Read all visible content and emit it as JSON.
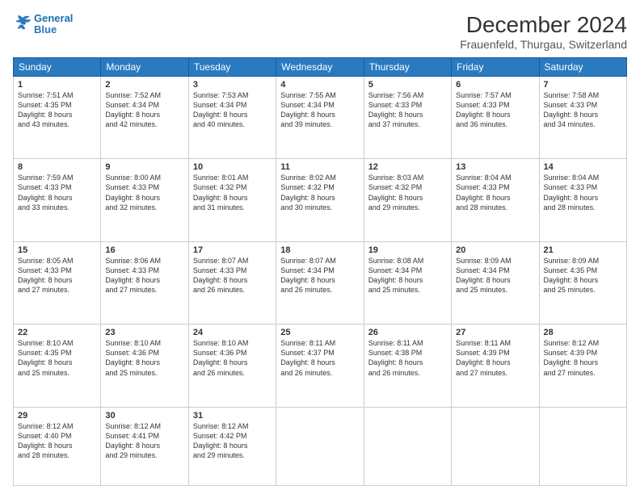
{
  "header": {
    "logo_line1": "General",
    "logo_line2": "Blue",
    "title": "December 2024",
    "subtitle": "Frauenfeld, Thurgau, Switzerland"
  },
  "weekdays": [
    "Sunday",
    "Monday",
    "Tuesday",
    "Wednesday",
    "Thursday",
    "Friday",
    "Saturday"
  ],
  "weeks": [
    [
      {
        "day": "1",
        "lines": [
          "Sunrise: 7:51 AM",
          "Sunset: 4:35 PM",
          "Daylight: 8 hours",
          "and 43 minutes."
        ]
      },
      {
        "day": "2",
        "lines": [
          "Sunrise: 7:52 AM",
          "Sunset: 4:34 PM",
          "Daylight: 8 hours",
          "and 42 minutes."
        ]
      },
      {
        "day": "3",
        "lines": [
          "Sunrise: 7:53 AM",
          "Sunset: 4:34 PM",
          "Daylight: 8 hours",
          "and 40 minutes."
        ]
      },
      {
        "day": "4",
        "lines": [
          "Sunrise: 7:55 AM",
          "Sunset: 4:34 PM",
          "Daylight: 8 hours",
          "and 39 minutes."
        ]
      },
      {
        "day": "5",
        "lines": [
          "Sunrise: 7:56 AM",
          "Sunset: 4:33 PM",
          "Daylight: 8 hours",
          "and 37 minutes."
        ]
      },
      {
        "day": "6",
        "lines": [
          "Sunrise: 7:57 AM",
          "Sunset: 4:33 PM",
          "Daylight: 8 hours",
          "and 36 minutes."
        ]
      },
      {
        "day": "7",
        "lines": [
          "Sunrise: 7:58 AM",
          "Sunset: 4:33 PM",
          "Daylight: 8 hours",
          "and 34 minutes."
        ]
      }
    ],
    [
      {
        "day": "8",
        "lines": [
          "Sunrise: 7:59 AM",
          "Sunset: 4:33 PM",
          "Daylight: 8 hours",
          "and 33 minutes."
        ]
      },
      {
        "day": "9",
        "lines": [
          "Sunrise: 8:00 AM",
          "Sunset: 4:33 PM",
          "Daylight: 8 hours",
          "and 32 minutes."
        ]
      },
      {
        "day": "10",
        "lines": [
          "Sunrise: 8:01 AM",
          "Sunset: 4:32 PM",
          "Daylight: 8 hours",
          "and 31 minutes."
        ]
      },
      {
        "day": "11",
        "lines": [
          "Sunrise: 8:02 AM",
          "Sunset: 4:32 PM",
          "Daylight: 8 hours",
          "and 30 minutes."
        ]
      },
      {
        "day": "12",
        "lines": [
          "Sunrise: 8:03 AM",
          "Sunset: 4:32 PM",
          "Daylight: 8 hours",
          "and 29 minutes."
        ]
      },
      {
        "day": "13",
        "lines": [
          "Sunrise: 8:04 AM",
          "Sunset: 4:33 PM",
          "Daylight: 8 hours",
          "and 28 minutes."
        ]
      },
      {
        "day": "14",
        "lines": [
          "Sunrise: 8:04 AM",
          "Sunset: 4:33 PM",
          "Daylight: 8 hours",
          "and 28 minutes."
        ]
      }
    ],
    [
      {
        "day": "15",
        "lines": [
          "Sunrise: 8:05 AM",
          "Sunset: 4:33 PM",
          "Daylight: 8 hours",
          "and 27 minutes."
        ]
      },
      {
        "day": "16",
        "lines": [
          "Sunrise: 8:06 AM",
          "Sunset: 4:33 PM",
          "Daylight: 8 hours",
          "and 27 minutes."
        ]
      },
      {
        "day": "17",
        "lines": [
          "Sunrise: 8:07 AM",
          "Sunset: 4:33 PM",
          "Daylight: 8 hours",
          "and 26 minutes."
        ]
      },
      {
        "day": "18",
        "lines": [
          "Sunrise: 8:07 AM",
          "Sunset: 4:34 PM",
          "Daylight: 8 hours",
          "and 26 minutes."
        ]
      },
      {
        "day": "19",
        "lines": [
          "Sunrise: 8:08 AM",
          "Sunset: 4:34 PM",
          "Daylight: 8 hours",
          "and 25 minutes."
        ]
      },
      {
        "day": "20",
        "lines": [
          "Sunrise: 8:09 AM",
          "Sunset: 4:34 PM",
          "Daylight: 8 hours",
          "and 25 minutes."
        ]
      },
      {
        "day": "21",
        "lines": [
          "Sunrise: 8:09 AM",
          "Sunset: 4:35 PM",
          "Daylight: 8 hours",
          "and 25 minutes."
        ]
      }
    ],
    [
      {
        "day": "22",
        "lines": [
          "Sunrise: 8:10 AM",
          "Sunset: 4:35 PM",
          "Daylight: 8 hours",
          "and 25 minutes."
        ]
      },
      {
        "day": "23",
        "lines": [
          "Sunrise: 8:10 AM",
          "Sunset: 4:36 PM",
          "Daylight: 8 hours",
          "and 25 minutes."
        ]
      },
      {
        "day": "24",
        "lines": [
          "Sunrise: 8:10 AM",
          "Sunset: 4:36 PM",
          "Daylight: 8 hours",
          "and 26 minutes."
        ]
      },
      {
        "day": "25",
        "lines": [
          "Sunrise: 8:11 AM",
          "Sunset: 4:37 PM",
          "Daylight: 8 hours",
          "and 26 minutes."
        ]
      },
      {
        "day": "26",
        "lines": [
          "Sunrise: 8:11 AM",
          "Sunset: 4:38 PM",
          "Daylight: 8 hours",
          "and 26 minutes."
        ]
      },
      {
        "day": "27",
        "lines": [
          "Sunrise: 8:11 AM",
          "Sunset: 4:39 PM",
          "Daylight: 8 hours",
          "and 27 minutes."
        ]
      },
      {
        "day": "28",
        "lines": [
          "Sunrise: 8:12 AM",
          "Sunset: 4:39 PM",
          "Daylight: 8 hours",
          "and 27 minutes."
        ]
      }
    ],
    [
      {
        "day": "29",
        "lines": [
          "Sunrise: 8:12 AM",
          "Sunset: 4:40 PM",
          "Daylight: 8 hours",
          "and 28 minutes."
        ]
      },
      {
        "day": "30",
        "lines": [
          "Sunrise: 8:12 AM",
          "Sunset: 4:41 PM",
          "Daylight: 8 hours",
          "and 29 minutes."
        ]
      },
      {
        "day": "31",
        "lines": [
          "Sunrise: 8:12 AM",
          "Sunset: 4:42 PM",
          "Daylight: 8 hours",
          "and 29 minutes."
        ]
      },
      null,
      null,
      null,
      null
    ]
  ]
}
